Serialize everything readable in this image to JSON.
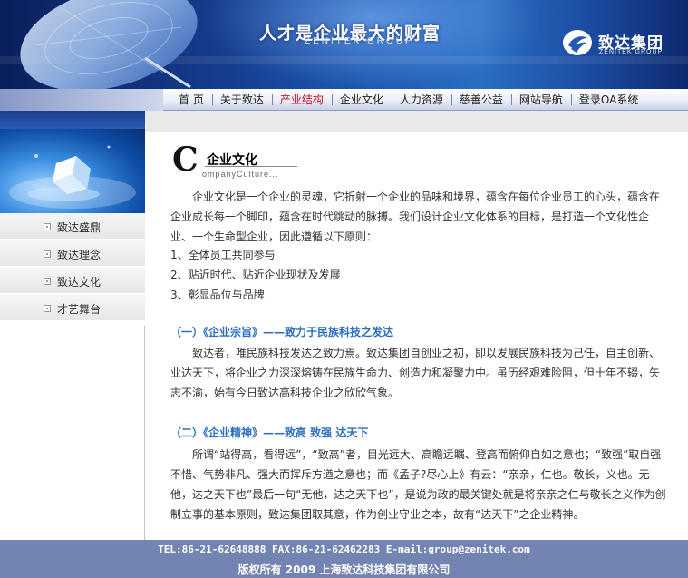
{
  "header": {
    "slogan": "人才是企业最大的财富",
    "slogan_en": "ZENITEK GROUP",
    "logo_cn": "致达集团",
    "logo_en": "ZENITEK GROUP",
    "logo_icon": "zenitek-logo-icon"
  },
  "nav": {
    "items": [
      "首 页",
      "关于致达",
      "产业结构",
      "企业文化",
      "人力资源",
      "慈善公益",
      "网站导航",
      "登录OA系统"
    ],
    "active_index": 2,
    "active_color": "#c8102e"
  },
  "sidebar": {
    "items": [
      "致达盛鼎",
      "致达理念",
      "致达文化",
      "才艺舞台"
    ]
  },
  "content": {
    "title_letter": "C",
    "title_cn": "企业文化",
    "title_en": "ompanyCulture...",
    "intro": "企业文化是一个企业的灵魂，它折射一个企业的品味和境界，蕴含在每位企业员工的心头，蕴含在企业成长每一个脚印，蕴含在时代跳动的脉搏。我们设计企业文化体系的目标，是打造一个文化性企业、一个生命型企业，因此遵循以下原则：",
    "principles": [
      "1、全体员工共同参与",
      "2、贴近时代、贴近企业现状及发展",
      "3、彰显品位与品牌"
    ],
    "section1_heading": "（一）《企业宗旨》——致力于民族科技之发达",
    "section1_body": "致达者，唯民族科技发达之致力焉。致达集团自创业之初，即以发展民族科技为己任，自主创新、业达天下，将企业之力深深熔铸在民族生命力、创造力和凝聚力中。虽历经艰难险阻，但十年不辍，矢志不渝，始有今日致达高科技企业之欣欣气象。",
    "section2_heading": "（二）《企业精神》——致高 致强 达天下",
    "section2_body": "所谓“站得高，看得远”，“致高”者，目光远大、高瞻远瞩、登高而俯仰自如之意也；“致强”取自强不惜、气势非凡、强大而挥斥方遒之意也；而《孟子?尽心上》有云：“亲亲，仁也。敬长，义也。无他，达之天下也”最后一句“无他，达之天下也”，是说为政的最关键处就是将亲亲之仁与敬长之义作为创制立事的基本原则，致达集团取其意，作为创业守业之本，故有“达天下”之企业精神。",
    "heading_color": "#2d6fc1"
  },
  "footer": {
    "contact": "TEL:86-21-62648888 FAX:86-21-62462283 E-mail:group@zenitek.com",
    "copyright": "版权所有 2009 上海致达科技集团有限公司",
    "background": "#7383b2"
  }
}
